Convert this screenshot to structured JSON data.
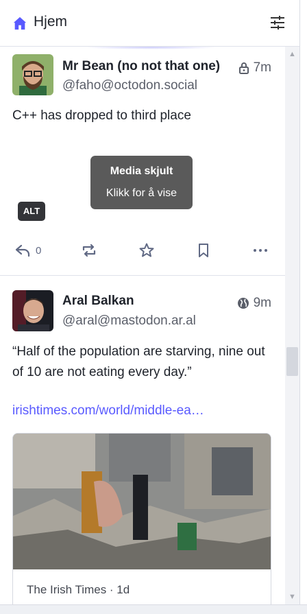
{
  "header": {
    "title": "Hjem",
    "home_icon": "home-icon",
    "filter_icon": "filter-sliders-icon",
    "accent": "#595aff"
  },
  "statuses": [
    {
      "display_name": "Mr Bean (no not that one)",
      "handle": "@faho@octodon.social",
      "visibility_icon": "lock-icon",
      "time": "7m",
      "content": "C++ has dropped to third place",
      "media_hidden": {
        "title": "Media skjult",
        "subtitle": "Klikk for å vise",
        "alt": "ALT"
      },
      "actions": {
        "reply_count": "0"
      }
    },
    {
      "display_name": "Aral Balkan",
      "handle": "@aral@mastodon.ar.al",
      "visibility_icon": "globe-icon",
      "time": "9m",
      "content": "“Half of the population are starving, nine out of 10 are not eating every day.”",
      "link": "irishtimes.com/world/middle-ea…",
      "card": {
        "source": "The Irish Times · 1d"
      }
    }
  ]
}
